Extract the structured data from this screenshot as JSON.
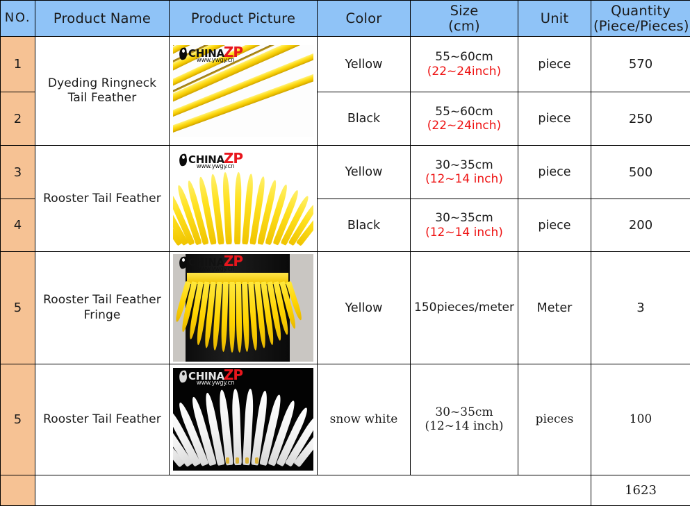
{
  "table": {
    "headers": [
      {
        "key": "no",
        "label": "NO."
      },
      {
        "key": "name",
        "label": "Product Name"
      },
      {
        "key": "picture",
        "label": "Product Picture"
      },
      {
        "key": "color",
        "label": "Color"
      },
      {
        "key": "size",
        "label": "Size\n(cm)",
        "line1": "Size",
        "line2": "(cm)"
      },
      {
        "key": "unit",
        "label": "Unit"
      },
      {
        "key": "qty",
        "label": "Quantity\n(Piece/Pieces)",
        "line1": "Quantity",
        "line2": "(Piece/Pieces)"
      }
    ],
    "rows": [
      {
        "no": "1",
        "name": "Dyeding Ringneck Tail Feather",
        "picture": "yellow-ringneck-tail-feather-strands-photo",
        "color": "Yellow",
        "size_cm": "55~60cm",
        "size_inch": "(22~24inch)",
        "unit": "piece",
        "qty": "570"
      },
      {
        "no": "2",
        "name": "Dyeding Ringneck Tail Feather",
        "picture": "yellow-ringneck-tail-feather-strands-photo",
        "color": "Black",
        "size_cm": "55~60cm",
        "size_inch": "(22~24inch)",
        "unit": "piece",
        "qty": "250"
      },
      {
        "no": "3",
        "name": "Rooster Tail  Feather",
        "picture": "yellow-rooster-tail-feather-bundle-photo",
        "color": "Yellow",
        "size_cm": "30~35cm",
        "size_inch": "(12~14 inch)",
        "unit": "piece",
        "qty": "500"
      },
      {
        "no": "4",
        "name": "Rooster Tail  Feather",
        "picture": "yellow-rooster-tail-feather-bundle-photo",
        "color": "Black",
        "size_cm": "30~35cm",
        "size_inch": "(12~14 inch)",
        "unit": "piece",
        "qty": "200"
      },
      {
        "no": "5",
        "name": "Rooster Tail  Feather Fringe",
        "picture": "yellow-feather-fringe-skirt-photo",
        "color": "Yellow",
        "size_cm": "150pieces/meter",
        "size_inch": "",
        "unit": "Meter",
        "qty": "3"
      },
      {
        "no": "5",
        "name": "Rooster Tail  Feather",
        "picture": "white-rooster-tail-feather-fan-photo",
        "color": "snow white",
        "size_cm": "30~35cm",
        "size_inch": "(12~14 inch)",
        "unit": "pieces",
        "qty": "100"
      }
    ],
    "total_row": {
      "no": "",
      "blank": "",
      "qty": "1623"
    }
  },
  "watermark": {
    "brand_black": "CHINA",
    "brand_red": "ZP",
    "url": "www.ywgy.cn"
  },
  "colors": {
    "header_bg": "#8fc3f7",
    "no_cell_bg": "#f6c294",
    "inch_text": "#ee1111",
    "border": "#000000",
    "brand_red": "#e8161d"
  }
}
